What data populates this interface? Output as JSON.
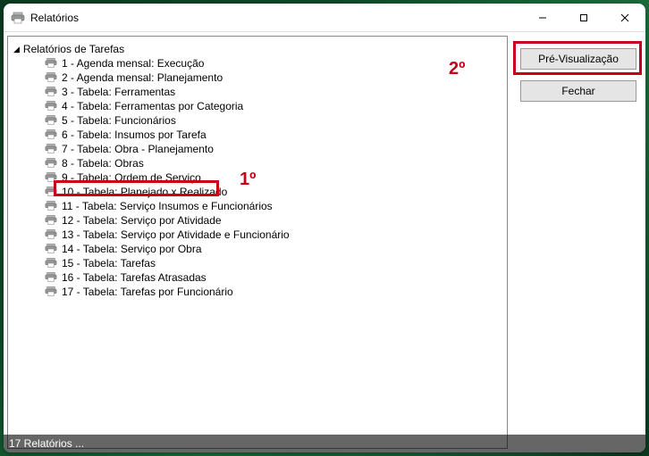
{
  "window": {
    "title": "Relatórios"
  },
  "tree": {
    "root_label": "Relatórios de Tarefas",
    "items": [
      "1 - Agenda mensal: Execução",
      "2 - Agenda mensal: Planejamento",
      "3 - Tabela: Ferramentas",
      "4 - Tabela: Ferramentas por Categoria",
      "5 - Tabela: Funcionários",
      "6 - Tabela: Insumos por Tarefa",
      "7 - Tabela: Obra - Planejamento",
      "8 - Tabela: Obras",
      "9 - Tabela: Ordem de Serviço",
      "10 - Tabela: Planejado x Realizado",
      "11 - Tabela: Serviço Insumos e Funcionários",
      "12 - Tabela: Serviço por Atividade",
      "13 - Tabela: Serviço por Atividade e Funcionário",
      "14 - Tabela: Serviço por Obra",
      "15 - Tabela: Tarefas",
      "16 - Tabela: Tarefas Atrasadas",
      "17 - Tabela: Tarefas por Funcionário"
    ]
  },
  "buttons": {
    "preview": "Pré-Visualização",
    "close": "Fechar"
  },
  "annotations": {
    "step1": "1º",
    "step2": "2º"
  },
  "statusbar": {
    "text": "17 Relatórios ..."
  },
  "highlight": {
    "color": "#c70018",
    "highlighted_item_index": 8
  }
}
